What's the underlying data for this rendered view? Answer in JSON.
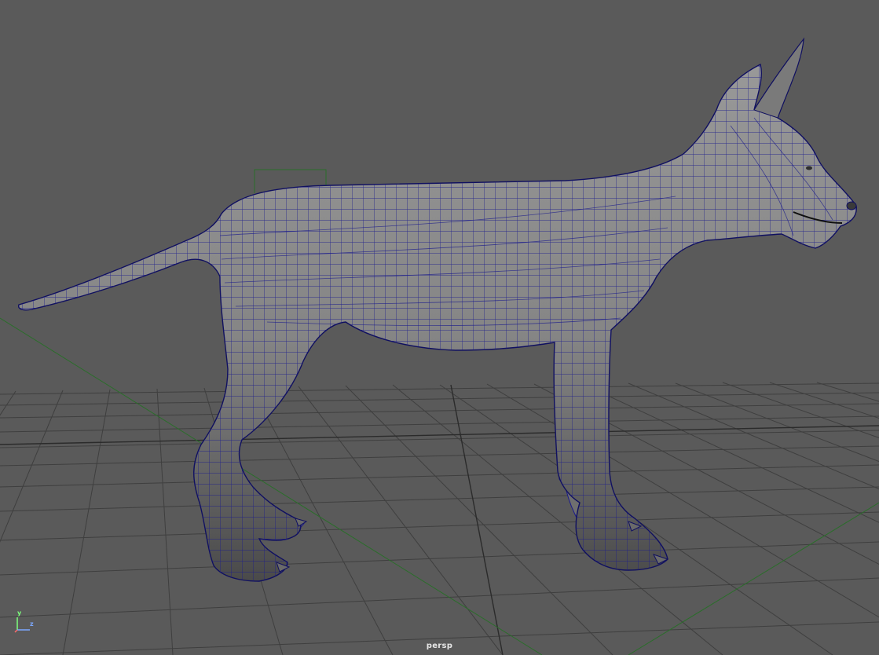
{
  "viewport": {
    "camera_name": "persp",
    "background_color": "#5a5a5a",
    "grid_color": "#3f3f3f",
    "grid_axis_color": "#1f1f1f",
    "mesh_wire_color": "#1a1a8c",
    "mesh_fill_color": "#8a8a8a",
    "origin_axis_color": "#2a6e2a"
  },
  "axis_gizmo": {
    "y_label": "y",
    "z_label": "z",
    "y_color": "#7cff7c",
    "z_color": "#7ca8ff",
    "x_color": "#ff6b6b"
  },
  "model": {
    "name": "dog-mesh",
    "shading": "smooth-shaded-with-wireframe"
  }
}
